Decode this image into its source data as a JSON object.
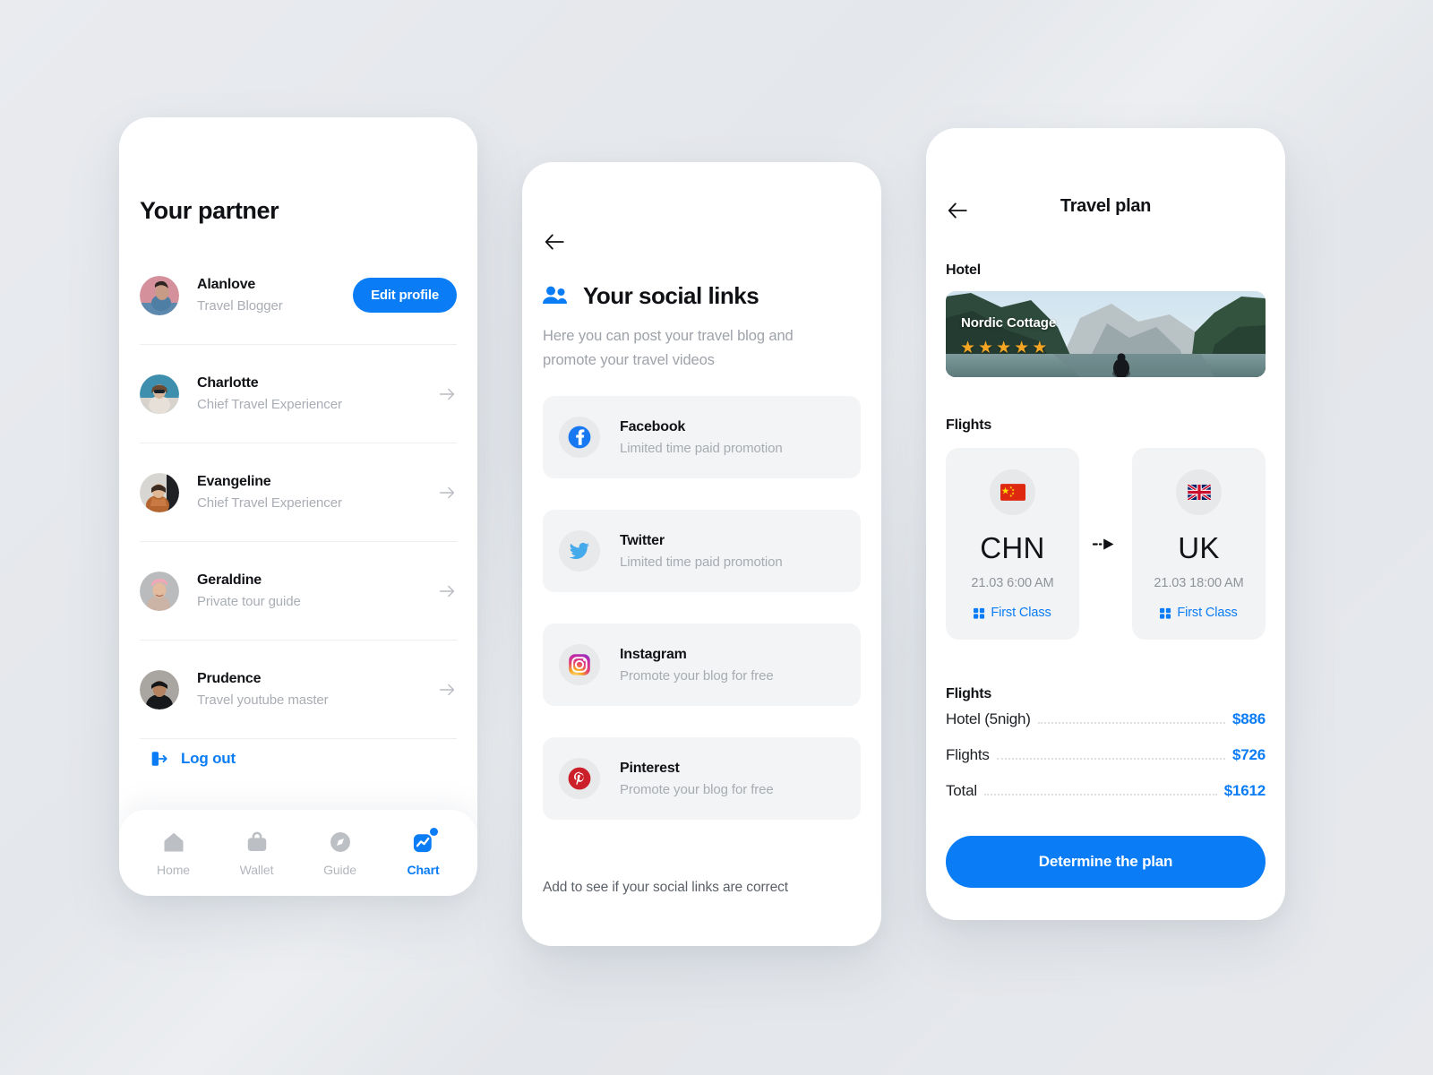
{
  "theme": {
    "accent": "#0a7cf5",
    "page_background": "#e6e8ec",
    "card_background": "#f3f4f5",
    "star_color": "#f5a524"
  },
  "partner_screen": {
    "title": "Your partner",
    "partners": [
      {
        "name": "Alanlove",
        "role": "Travel Blogger",
        "action": "Edit profile",
        "avatar": "avatar-alanlove"
      },
      {
        "name": "Charlotte",
        "role": "Chief Travel Experiencer",
        "action": "",
        "avatar": "avatar-charlotte"
      },
      {
        "name": "Evangeline",
        "role": "Chief Travel Experiencer",
        "action": "",
        "avatar": "avatar-evangeline"
      },
      {
        "name": "Geraldine",
        "role": "Private tour guide",
        "action": "",
        "avatar": "avatar-geraldine"
      },
      {
        "name": "Prudence",
        "role": "Travel youtube master",
        "action": "",
        "avatar": "avatar-prudence"
      }
    ],
    "logout_label": "Log out",
    "logout_icon": "logout-icon",
    "tabs": [
      {
        "label": "Home",
        "icon": "home-icon",
        "active": false,
        "badge": false
      },
      {
        "label": "Wallet",
        "icon": "wallet-icon",
        "active": false,
        "badge": false
      },
      {
        "label": "Guide",
        "icon": "compass-icon",
        "active": false,
        "badge": false
      },
      {
        "label": "Chart",
        "icon": "chart-icon",
        "active": true,
        "badge": true
      }
    ]
  },
  "social_screen": {
    "back_icon": "arrow-left-icon",
    "header_icon": "people-group-icon",
    "title": "Your social links",
    "subtitle": "Here you can post your travel blog and promote your travel videos",
    "links": [
      {
        "name": "Facebook",
        "desc": "Limited time paid promotion",
        "icon": "facebook-icon"
      },
      {
        "name": "Twitter",
        "desc": "Limited time paid promotion",
        "icon": "twitter-icon"
      },
      {
        "name": "Instagram",
        "desc": "Promote your blog for free",
        "icon": "instagram-icon"
      },
      {
        "name": "Pinterest",
        "desc": "Promote your blog for free",
        "icon": "pinterest-icon"
      }
    ],
    "footer_note": "Add to see if your social links are correct"
  },
  "plan_screen": {
    "back_icon": "arrow-left-icon",
    "title": "Travel plan",
    "hotel_label": "Hotel",
    "hotel": {
      "name": "Nordic Cottage",
      "stars": 5,
      "star_glyph": "★"
    },
    "flights_label": "Flights",
    "flights": [
      {
        "code": "CHN",
        "time": "21.03 6:00 AM",
        "class": "First Class",
        "flag": "flag-china",
        "ticket_icon": "ticket-icon"
      },
      {
        "code": "UK",
        "time": "21.03 18:00 AM",
        "class": "First Class",
        "flag": "flag-uk",
        "ticket_icon": "ticket-icon"
      }
    ],
    "flight_arrow_icon": "flight-direction-icon",
    "costs_label": "Flights",
    "costs": [
      {
        "name": "Hotel (5nigh)",
        "value": "$886"
      },
      {
        "name": "Flights",
        "value": "$726"
      },
      {
        "name": "Total",
        "value": "$1612"
      }
    ],
    "cta_label": "Determine the plan"
  }
}
